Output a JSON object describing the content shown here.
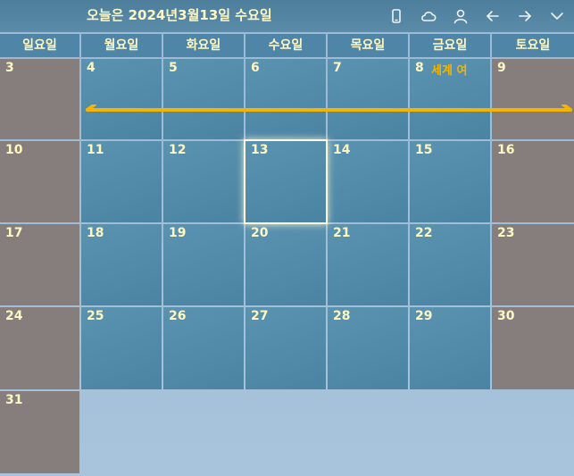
{
  "header": {
    "today_text": "오늘은 2024년3월13일 수요일",
    "icons": [
      "phone-icon",
      "cloud-icon",
      "user-icon",
      "arrow-left-icon",
      "arrow-right-icon",
      "chevron-down-icon"
    ]
  },
  "weekdays": [
    "일요일",
    "월요일",
    "화요일",
    "수요일",
    "목요일",
    "금요일",
    "토요일"
  ],
  "weeks": [
    [
      "3",
      "4",
      "5",
      "6",
      "7",
      "8",
      "9"
    ],
    [
      "10",
      "11",
      "12",
      "13",
      "14",
      "15",
      "16"
    ],
    [
      "17",
      "18",
      "19",
      "20",
      "21",
      "22",
      "23"
    ],
    [
      "24",
      "25",
      "26",
      "27",
      "28",
      "29",
      "30"
    ],
    [
      "31"
    ]
  ],
  "events": [
    {
      "label": "세계 여",
      "start_day": "8"
    }
  ],
  "colors": {
    "weekday_cell": "#4f88a8",
    "weekend_cell": "#857e7c",
    "day_number": "#fff7c2",
    "event": "#f6b400",
    "today_outline": "#fffde0"
  }
}
